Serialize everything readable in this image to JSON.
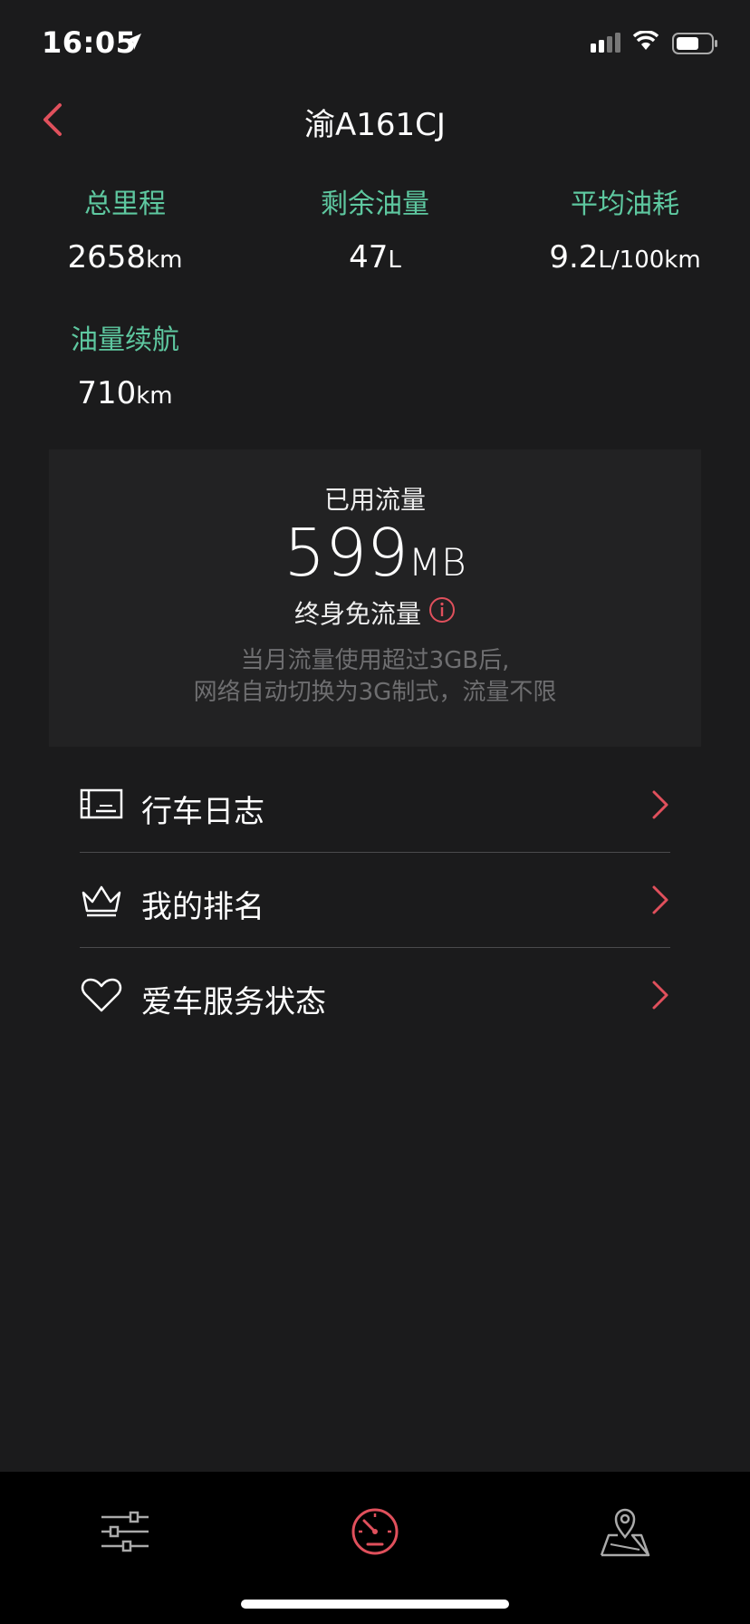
{
  "status_bar": {
    "time": "16:05"
  },
  "nav": {
    "title": "渝A161CJ"
  },
  "stats": {
    "total_mileage": {
      "label": "总里程",
      "value": "2658",
      "unit": "km"
    },
    "fuel_left": {
      "label": "剩余油量",
      "value": "47",
      "unit": "L"
    },
    "avg_consumption": {
      "label": "平均油耗",
      "value": "9.2",
      "unit": "L/100km"
    },
    "fuel_range": {
      "label": "油量续航",
      "value": "710",
      "unit": "km"
    }
  },
  "data_usage": {
    "label": "已用流量",
    "value": "599",
    "unit": "MB",
    "plan": "终身免流量",
    "note_line1": "当月流量使用超过3GB后,",
    "note_line2": "网络自动切换为3G制式，流量不限"
  },
  "menu": [
    {
      "label": "行车日志",
      "icon": "logbook-icon"
    },
    {
      "label": "我的排名",
      "icon": "crown-icon"
    },
    {
      "label": "爱车服务状态",
      "icon": "heart-icon"
    }
  ],
  "colors": {
    "accent": "#e0505c",
    "stat_label": "#5ec8a0",
    "background": "#1b1b1c"
  }
}
